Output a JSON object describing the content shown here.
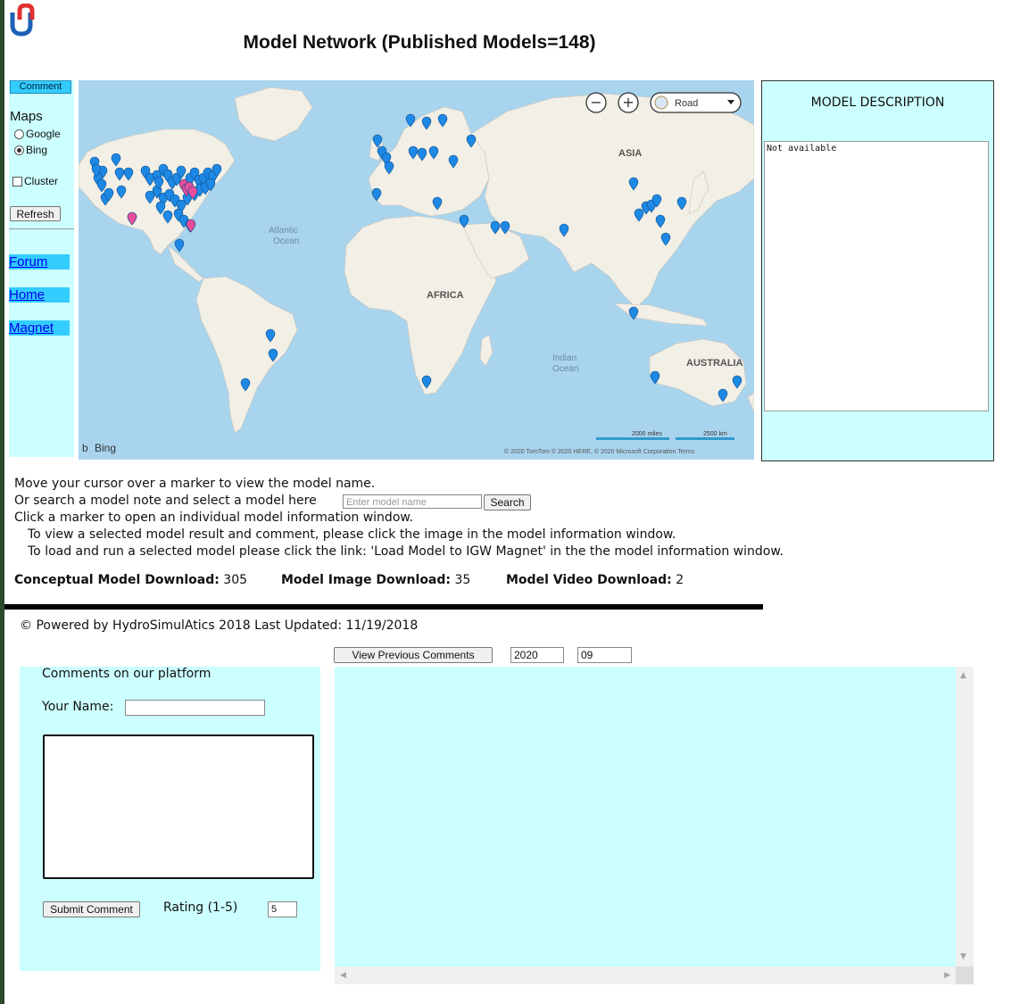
{
  "title": "Model Network (Published Models=148)",
  "sidebar": {
    "comment_button": "Comment",
    "maps_label": "Maps",
    "options": [
      {
        "label": "Google",
        "selected": false
      },
      {
        "label": "Bing",
        "selected": true
      }
    ],
    "cluster_label": "Cluster",
    "refresh_button": "Refresh",
    "links": [
      "Forum",
      "Home",
      "Magnet"
    ]
  },
  "map": {
    "zoom_out": "−",
    "zoom_in": "+",
    "style_select": "Road",
    "labels": {
      "asia": "ASIA",
      "atlantic1": "Atlantic",
      "atlantic2": "Ocean",
      "africa": "AFRICA",
      "indian1": "Indian",
      "indian2": "Ocean",
      "australia": "AUSTRALIA"
    },
    "brand": "Bing",
    "scale_miles": "2000 miles",
    "scale_km": "2500 km",
    "copyright": "© 2020 TomTom © 2020 HERE, © 2020 Microsoft Corporation  Terms"
  },
  "description": {
    "title": "MODEL DESCRIPTION",
    "text": "Not available"
  },
  "instructions": {
    "line1": "Move your cursor over a marker to view the model name.",
    "line2": "Or search a model note and select a model here",
    "search_placeholder": "Enter model name",
    "search_button": "Search",
    "line3": "Click a marker to open an individual model information window.",
    "line4": "To view a selected model result and comment, please click the image in the model information window.",
    "line5": "To load and run a selected model please click the link: 'Load Model to IGW Magnet' in the the model information window."
  },
  "stats": [
    {
      "label": "Conceptual Model Download:",
      "value": "305"
    },
    {
      "label": "Model Image Download:",
      "value": "35"
    },
    {
      "label": "Model Video Download:",
      "value": "2"
    }
  ],
  "footer": "© Powered by HydroSimulAtics 2018 Last Updated: 11/19/2018",
  "comments": {
    "title": "Comments on our platform",
    "name_label": "Your Name:",
    "submit_button": "Submit Comment",
    "rating_label": "Rating (1-5)",
    "rating_value": "5",
    "view_button": "View Previous Comments",
    "year": "2020",
    "month": "09"
  },
  "colors": {
    "panel": "#ccffff",
    "accent": "#33ccff",
    "marker": "#1e88e5",
    "marker_pink": "#e84c9b"
  }
}
